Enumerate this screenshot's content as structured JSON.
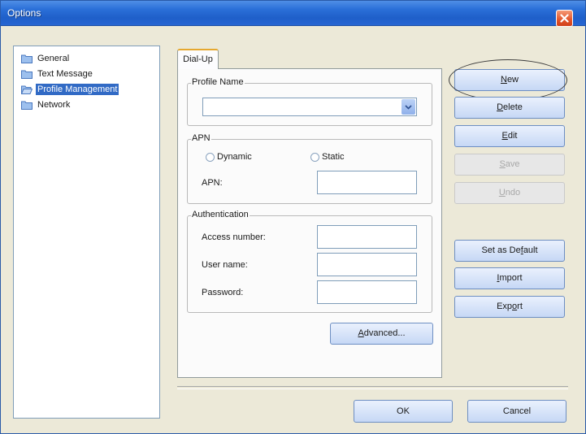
{
  "window": {
    "title": "Options"
  },
  "tree": {
    "items": [
      {
        "label": "General",
        "selected": false
      },
      {
        "label": "Text Message",
        "selected": false
      },
      {
        "label": "Profile Management",
        "selected": true
      },
      {
        "label": "Network",
        "selected": false
      }
    ]
  },
  "tabs": {
    "active": "Dial-Up"
  },
  "profile": {
    "group_title": "Profile Name",
    "selected_value": ""
  },
  "apn": {
    "group_title": "APN",
    "dynamic_label": "Dynamic",
    "static_label": "Static",
    "apn_label": "APN:",
    "apn_value": ""
  },
  "auth": {
    "group_title": "Authentication",
    "access_number_label": "Access number:",
    "access_number_value": "",
    "user_name_label": "User name:",
    "user_name_value": "",
    "password_label": "Password:",
    "password_value": ""
  },
  "buttons": {
    "new": {
      "pre": "",
      "u": "N",
      "post": "ew"
    },
    "delete": {
      "pre": "",
      "u": "D",
      "post": "elete"
    },
    "edit": {
      "pre": "",
      "u": "E",
      "post": "dit"
    },
    "save": {
      "pre": "",
      "u": "S",
      "post": "ave"
    },
    "undo": {
      "pre": "",
      "u": "U",
      "post": "ndo"
    },
    "set_default": {
      "pre": "Set as De",
      "u": "f",
      "post": "ault"
    },
    "import": {
      "pre": "",
      "u": "I",
      "post": "mport"
    },
    "export": {
      "pre": "Exp",
      "u": "o",
      "post": "rt"
    },
    "advanced": {
      "pre": "",
      "u": "A",
      "post": "dvanced..."
    },
    "ok": "OK",
    "cancel": "Cancel"
  },
  "colors": {
    "selection": "#316ac5",
    "titlebar": "#2a6fd8",
    "close": "#e2542a",
    "folder": "#8fb3e8"
  },
  "icons": {
    "folder": "folder-icon",
    "open_folder": "folder-open-icon",
    "close": "close-icon",
    "dropdown": "chevron-down-icon"
  }
}
